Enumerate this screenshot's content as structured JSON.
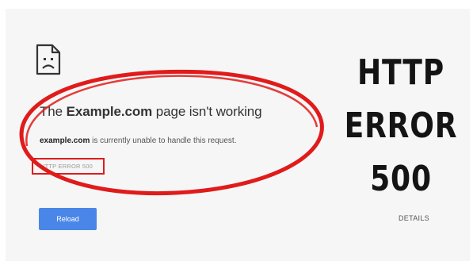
{
  "error_page": {
    "title_prefix": "The ",
    "title_site": "Example.com",
    "title_suffix": " page isn't working",
    "description_site": "example.com",
    "description_text": " is currently unable to handle this request.",
    "error_code": "HTTP ERROR 500",
    "reload_label": "Reload",
    "details_label": "DETAILS"
  },
  "overlay": {
    "line1": "HTTP",
    "line2": "ERROR",
    "line3": "500"
  },
  "icons": {
    "page_icon": "sad-document-icon"
  },
  "colors": {
    "annotation_red": "#e01b1b",
    "button_blue": "#4a86e8",
    "background": "#f6f6f6"
  }
}
